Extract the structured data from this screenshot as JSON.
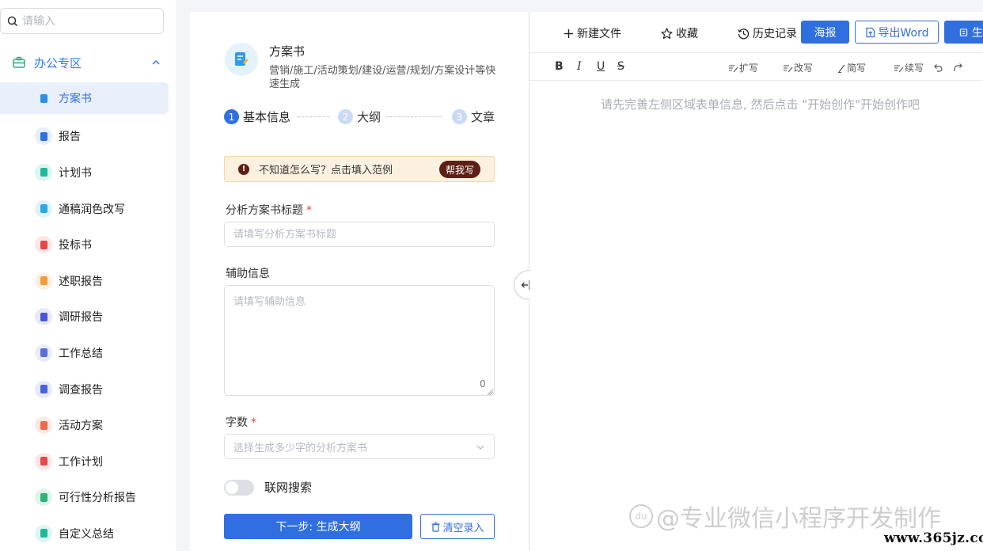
{
  "sidebar": {
    "search_placeholder": "请输入",
    "group_title": "办公专区",
    "items": [
      {
        "label": "方案书",
        "color": "#2f8fe8",
        "bg": "#e3f1fd"
      },
      {
        "label": "报告",
        "color": "#2f6fe0",
        "bg": "#e6eefc"
      },
      {
        "label": "计划书",
        "color": "#22b89e",
        "bg": "#ddf6f1"
      },
      {
        "label": "通稿润色改写",
        "color": "#2ba6e8",
        "bg": "#e0f3fc"
      },
      {
        "label": "投标书",
        "color": "#e8474a",
        "bg": "#fde6e6"
      },
      {
        "label": "述职报告",
        "color": "#f09a3a",
        "bg": "#fdf0e0"
      },
      {
        "label": "调研报告",
        "color": "#4a56d8",
        "bg": "#e7e9fb"
      },
      {
        "label": "工作总结",
        "color": "#5a6fd8",
        "bg": "#e9ecfb"
      },
      {
        "label": "调查报告",
        "color": "#4a62e0",
        "bg": "#e6eafc"
      },
      {
        "label": "活动方案",
        "color": "#ef6a4a",
        "bg": "#fde9e3"
      },
      {
        "label": "工作计划",
        "color": "#e8474a",
        "bg": "#fde6e6"
      },
      {
        "label": "可行性分析报告",
        "color": "#2fb27a",
        "bg": "#def5ea"
      },
      {
        "label": "自定义总结",
        "color": "#22b89e",
        "bg": "#ddf6f1"
      }
    ]
  },
  "form": {
    "title": "方案书",
    "description": "营销/施工/活动策划/建设/运营/规划/方案设计等快速生成",
    "steps": [
      {
        "num": "1",
        "label": "基本信息"
      },
      {
        "num": "2",
        "label": "大纲"
      },
      {
        "num": "3",
        "label": "文章"
      }
    ],
    "tip_text": "不知道怎么写？点击填入范例",
    "tip_button": "帮我写",
    "title_label": "分析方案书标题",
    "required_mark": "*",
    "title_placeholder": "请填写分析方案书标题",
    "aux_label": "辅助信息",
    "aux_placeholder": "请填写辅助信息",
    "aux_count": "0",
    "words_label": "字数",
    "words_placeholder": "选择生成多少字的分析方案书",
    "web_search_label": "联网搜索",
    "next_button": "下一步: 生成大纲",
    "clear_button": "清空录入"
  },
  "editor": {
    "toolbar": {
      "new_file": "新建文件",
      "favorite": "收藏",
      "history": "历史记录",
      "poster": "海报",
      "export_word": "导出Word",
      "generate": "生"
    },
    "format": {
      "bold": "B",
      "italic": "I",
      "underline": "U",
      "strike": "S",
      "expand": "扩写",
      "rewrite": "改写",
      "simplify": "简写",
      "continue": "续写"
    },
    "placeholder": "请先完善左侧区域表单信息, 然后点击 \"开始创作\"开始创作吧"
  },
  "watermark": {
    "logo": "du",
    "text": "@专业微信小程序开发制作",
    "site": "www.365jz.com"
  },
  "colors": {
    "primary": "#2f6fe0",
    "tip_bg": "#fcf1e0",
    "tip_accent": "#5e1f14"
  }
}
